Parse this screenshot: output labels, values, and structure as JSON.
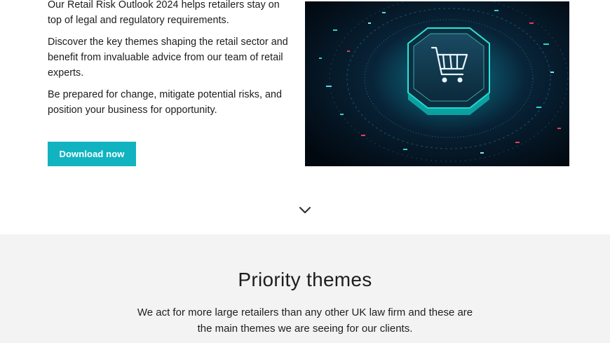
{
  "hero": {
    "paragraphs": [
      "Our Retail Risk Outlook 2024 helps retailers stay on top of legal and regulatory requirements.",
      "Discover the key themes shaping the retail sector and benefit from invaluable advice from our team of retail experts.",
      "Be prepared for change, mitigate potential risks, and position your business for opportunity."
    ],
    "cta_label": "Download now",
    "cta_color": "#12b3c0",
    "image_icon": "shopping-cart-on-chip-icon"
  },
  "scroll_icon": "chevron-down-icon",
  "themes": {
    "title": "Priority themes",
    "description": "We act for more large retailers than any other UK law firm and these are the main themes we are seeing for our clients."
  },
  "colors": {
    "accent": "#12b3c0",
    "section_bg": "#f3f3f3"
  }
}
